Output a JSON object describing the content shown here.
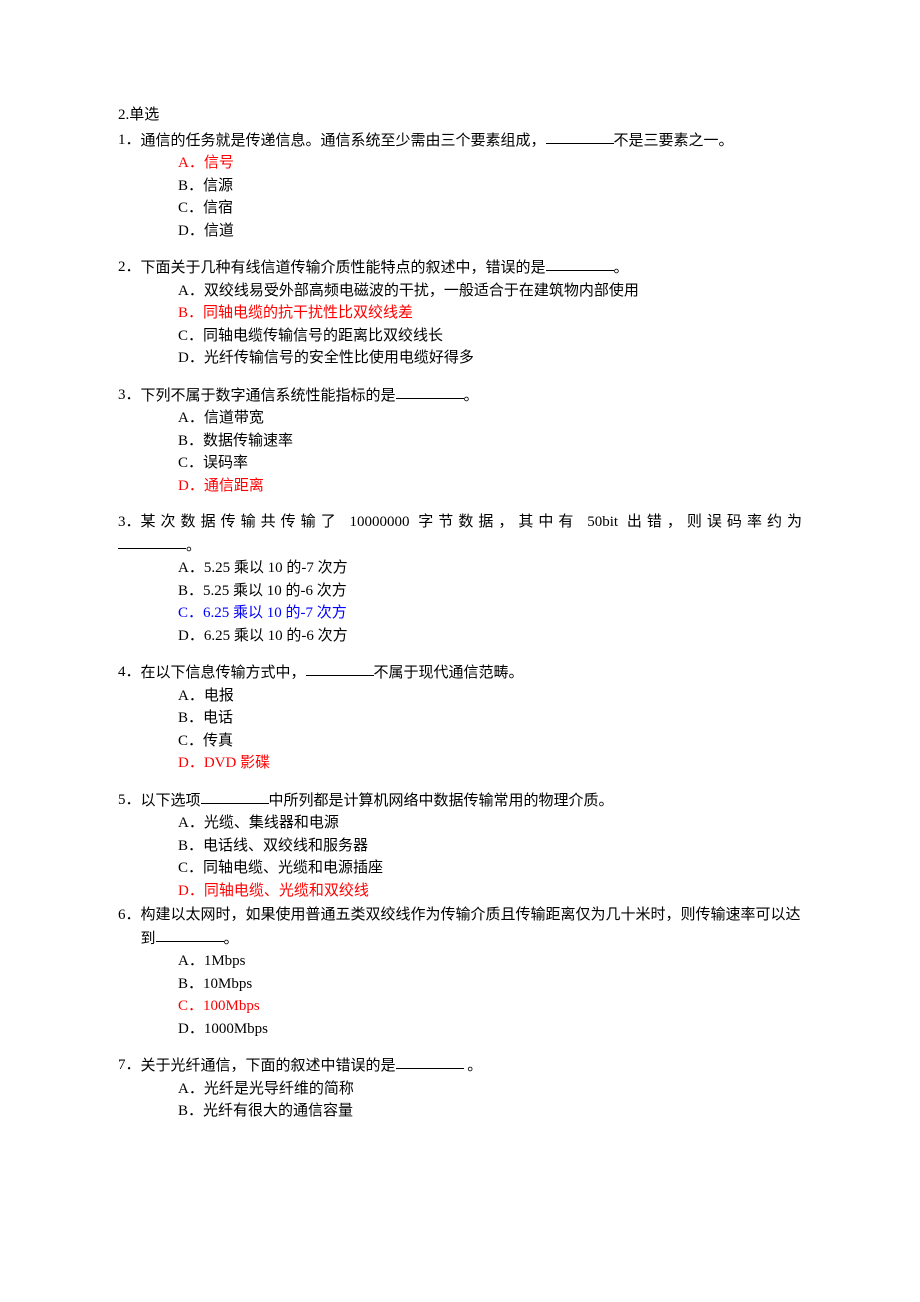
{
  "header": {
    "section": "2.单选"
  },
  "questions": [
    {
      "num": "1．",
      "stem": "通信的任务就是传递信息。通信系统至少需由三个要素组成，________不是三要素之一。",
      "options": [
        {
          "label": "A．",
          "text": "信号",
          "cls": "red"
        },
        {
          "label": "B．",
          "text": "信源",
          "cls": ""
        },
        {
          "label": "C．",
          "text": "信宿",
          "cls": ""
        },
        {
          "label": "D．",
          "text": "信道",
          "cls": ""
        }
      ]
    },
    {
      "num": "2．",
      "stem": "下面关于几种有线信道传输介质性能特点的叙述中，错误的是________。",
      "options": [
        {
          "label": "A．",
          "text": "双绞线易受外部高频电磁波的干扰，一般适合于在建筑物内部使用",
          "cls": ""
        },
        {
          "label": "B．",
          "text": "同轴电缆的抗干扰性比双绞线差",
          "cls": "red"
        },
        {
          "label": "C．",
          "text": "同轴电缆传输信号的距离比双绞线长",
          "cls": ""
        },
        {
          "label": "D．",
          "text": "光纤传输信号的安全性比使用电缆好得多",
          "cls": ""
        }
      ]
    },
    {
      "num": "3．",
      "stem": "下列不属于数字通信系统性能指标的是________。",
      "options": [
        {
          "label": "A．",
          "text": "信道带宽",
          "cls": ""
        },
        {
          "label": "B．",
          "text": "数据传输速率",
          "cls": ""
        },
        {
          "label": "C．",
          "text": "误码率",
          "cls": ""
        },
        {
          "label": "D．",
          "text": "通信距离",
          "cls": "red"
        }
      ]
    },
    {
      "num": "3．",
      "stem_spread": "某次数据传输共传输了 10000000 字节数据，其中有 50bit 出错，则误码率约为",
      "stem_cont": "________。",
      "options": [
        {
          "label": "A．",
          "text": "5.25 乘以 10 的-7 次方",
          "cls": ""
        },
        {
          "label": "B．",
          "text": "5.25 乘以 10 的-6 次方",
          "cls": ""
        },
        {
          "label": "C．",
          "text": "6.25 乘以 10 的-7 次方",
          "cls": "blue"
        },
        {
          "label": "D．",
          "text": "6.25 乘以 10 的-6 次方",
          "cls": ""
        }
      ]
    },
    {
      "num": "4．",
      "stem": "在以下信息传输方式中，________不属于现代通信范畴。",
      "options": [
        {
          "label": "A．",
          "text": "电报",
          "cls": ""
        },
        {
          "label": "B．",
          "text": "电话",
          "cls": ""
        },
        {
          "label": "C．",
          "text": "传真",
          "cls": ""
        },
        {
          "label": "D．",
          "text": "DVD 影碟",
          "cls": "red"
        }
      ]
    },
    {
      "num": "5．",
      "stem": "以下选项________中所列都是计算机网络中数据传输常用的物理介质。",
      "options": [
        {
          "label": "A．",
          "text": "光缆、集线器和电源",
          "cls": ""
        },
        {
          "label": "B．",
          "text": "电话线、双绞线和服务器",
          "cls": ""
        },
        {
          "label": "C．",
          "text": "同轴电缆、光缆和电源插座",
          "cls": ""
        },
        {
          "label": "D．",
          "text": "同轴电缆、光缆和双绞线",
          "cls": "red"
        }
      ]
    },
    {
      "num": "6．",
      "stem": "构建以太网时，如果使用普通五类双绞线作为传输介质且传输距离仅为几十米时，则传输速率可以达到________。",
      "stem_indent": true,
      "options": [
        {
          "label": "A．",
          "text": "1Mbps",
          "cls": ""
        },
        {
          "label": "B．",
          "text": "10Mbps",
          "cls": ""
        },
        {
          "label": "C．",
          "text": "100Mbps",
          "cls": "red"
        },
        {
          "label": "D．",
          "text": "1000Mbps",
          "cls": ""
        }
      ]
    },
    {
      "num": "7．",
      "stem": "关于光纤通信，下面的叙述中错误的是________ 。",
      "options": [
        {
          "label": "A．",
          "text": "光纤是光导纤维的简称",
          "cls": ""
        },
        {
          "label": "B．",
          "text": "光纤有很大的通信容量",
          "cls": ""
        }
      ]
    }
  ]
}
